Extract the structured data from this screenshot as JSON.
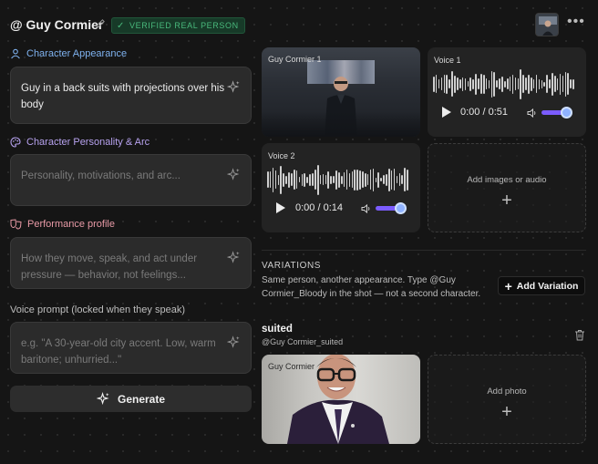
{
  "header": {
    "title": "@ Guy Cormier",
    "badge": "VERIFIED REAL PERSON"
  },
  "sections": {
    "appearance": {
      "label": "Character Appearance",
      "value": "Guy in a back suits with projections over his body",
      "placeholder": ""
    },
    "personality": {
      "label": "Character Personality & Arc",
      "value": "",
      "placeholder": "Personality, motivations, and arc..."
    },
    "performance": {
      "label": "Performance profile",
      "value": "",
      "placeholder": "How they move, speak, and act under pressure — behavior, not feelings..."
    },
    "voice_prompt": {
      "label": "Voice prompt (locked when they speak)",
      "value": "",
      "placeholder": "e.g. \"A 30-year-old city accent. Low, warm baritone; unhurried...\""
    }
  },
  "generate_label": "Generate",
  "media": {
    "video_label": "Guy Cormier 1",
    "voice1": {
      "label": "Voice 1",
      "time": "0:00 / 0:51",
      "volume": 0.85
    },
    "voice2": {
      "label": "Voice 2",
      "time": "0:00 / 0:14",
      "volume": 0.85
    },
    "add_media_label": "Add images or audio"
  },
  "variations": {
    "title": "VARIATIONS",
    "description": "Same person, another appearance. Type @Guy Cormier_Bloody in the shot — not a second character.",
    "add_label": "Add Variation",
    "item": {
      "name": "suited",
      "handle": "@Guy Cormier_suited",
      "photo_label": "Guy Cormier",
      "add_photo_label": "Add photo"
    }
  },
  "colors": {
    "accent": "#7b5cff",
    "verified": "#49b97c",
    "appearance": "#7fb2ef",
    "personality": "#b7a2ef",
    "performance": "#e89aa6"
  }
}
